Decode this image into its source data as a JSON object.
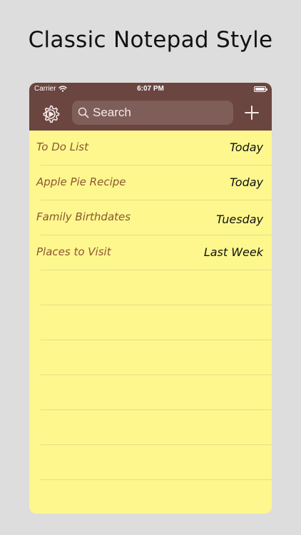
{
  "headline": "Classic Notepad Style",
  "status_bar": {
    "carrier": "Carrier",
    "time": "6:07 PM"
  },
  "nav": {
    "settings_icon": "gear-play-icon",
    "search_placeholder": "Search",
    "add_icon": "plus-icon"
  },
  "notes": [
    {
      "title": "To Do List",
      "date": "Today"
    },
    {
      "title": "Apple Pie Recipe",
      "date": "Today"
    },
    {
      "title": "Family Birthdates",
      "date": "Tuesday"
    },
    {
      "title": "Places to Visit",
      "date": "Last Week"
    }
  ],
  "colors": {
    "nav_background": "#6b4540",
    "search_background": "#7f5e59",
    "paper": "#fdf78e",
    "title_text": "#8b5632",
    "date_text": "#111111",
    "page_background": "#dddddd"
  }
}
